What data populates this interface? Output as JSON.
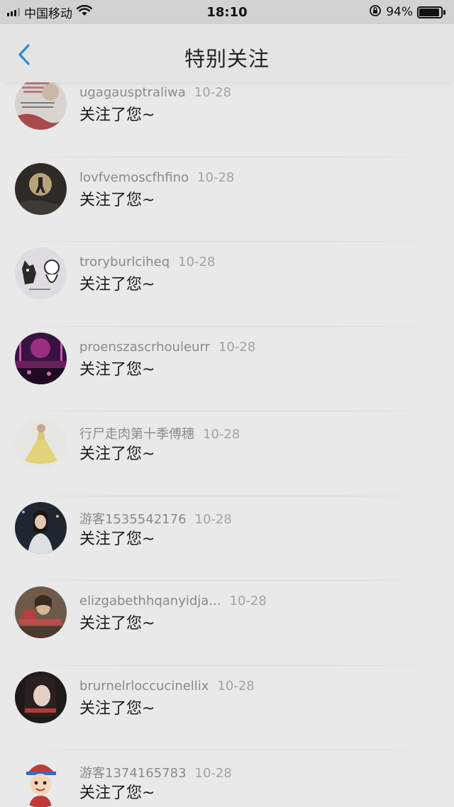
{
  "status_bar": {
    "carrier": "中国移动",
    "time": "18:10",
    "battery": "94%"
  },
  "nav": {
    "title": "特别关注",
    "back_icon": "chevron-left-icon",
    "accent": "#2e8bd6"
  },
  "list": {
    "items": [
      {
        "name": "ugagausptraliwa",
        "date": "10-28",
        "action": "关注了您~"
      },
      {
        "name": "lovfvemoscfhfino",
        "date": "10-28",
        "action": "关注了您~"
      },
      {
        "name": "troryburlciheq",
        "date": "10-28",
        "action": "关注了您~"
      },
      {
        "name": "proenszascrhouleurr",
        "date": "10-28",
        "action": "关注了您~"
      },
      {
        "name": "行尸走肉第十季傅穗",
        "date": "10-28",
        "action": "关注了您~"
      },
      {
        "name": "游客1535542176",
        "date": "10-28",
        "action": "关注了您~"
      },
      {
        "name": "elizgabethhqanyidja...",
        "date": "10-28",
        "action": "关注了您~"
      },
      {
        "name": "brurnelrloccucinellix",
        "date": "10-28",
        "action": "关注了您~"
      },
      {
        "name": "游客1374165783",
        "date": "10-28",
        "action": "关注了您~"
      }
    ]
  }
}
